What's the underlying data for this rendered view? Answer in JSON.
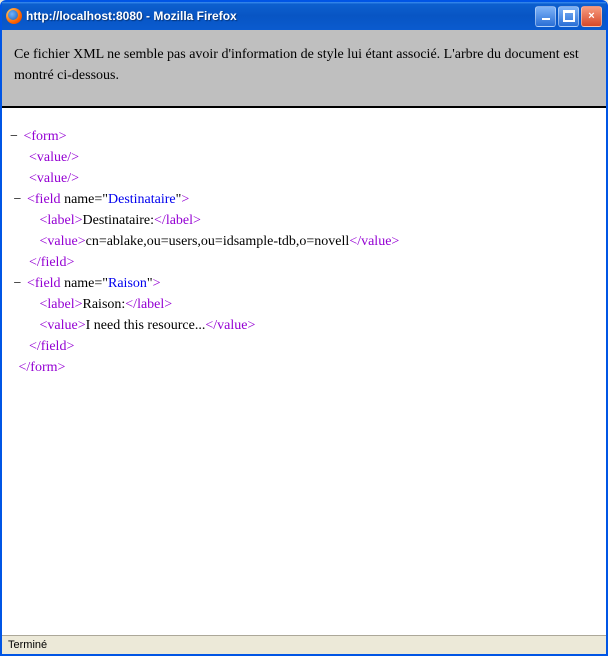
{
  "window": {
    "title": "http://localhost:8080 - Mozilla Firefox"
  },
  "banner": {
    "text": "Ce fichier XML ne semble pas avoir d'information de style lui étant associé. L'arbre du document est montré ci-dessous."
  },
  "xml": {
    "toggle": "−",
    "lines": [
      {
        "indent": 0,
        "toggle": true,
        "parts": [
          {
            "t": "tag",
            "v": "<form>"
          }
        ]
      },
      {
        "indent": 2,
        "toggle": false,
        "parts": [
          {
            "t": "tag",
            "v": "<value/>"
          }
        ]
      },
      {
        "indent": 2,
        "toggle": false,
        "parts": [
          {
            "t": "tag",
            "v": "<value/>"
          }
        ]
      },
      {
        "indent": 1,
        "toggle": true,
        "parts": [
          {
            "t": "tag",
            "v": "<field "
          },
          {
            "t": "attr-name",
            "v": "name=\""
          },
          {
            "t": "attr-val",
            "v": "Destinataire"
          },
          {
            "t": "attr-name",
            "v": "\""
          },
          {
            "t": "tag",
            "v": ">"
          }
        ]
      },
      {
        "indent": 3,
        "toggle": false,
        "parts": [
          {
            "t": "tag",
            "v": "<label>"
          },
          {
            "t": "text",
            "v": "Destinataire:"
          },
          {
            "t": "tag",
            "v": "</label>"
          }
        ]
      },
      {
        "indent": 3,
        "toggle": false,
        "parts": [
          {
            "t": "tag",
            "v": "<value>"
          },
          {
            "t": "text",
            "v": "cn=ablake,ou=users,ou=idsample-tdb,o=novell"
          },
          {
            "t": "tag",
            "v": "</value>"
          }
        ]
      },
      {
        "indent": 2,
        "toggle": false,
        "parts": [
          {
            "t": "tag",
            "v": "</field>"
          }
        ]
      },
      {
        "indent": 1,
        "toggle": true,
        "parts": [
          {
            "t": "tag",
            "v": "<field "
          },
          {
            "t": "attr-name",
            "v": "name=\""
          },
          {
            "t": "attr-val",
            "v": "Raison"
          },
          {
            "t": "attr-name",
            "v": "\""
          },
          {
            "t": "tag",
            "v": ">"
          }
        ]
      },
      {
        "indent": 3,
        "toggle": false,
        "parts": [
          {
            "t": "tag",
            "v": "<label>"
          },
          {
            "t": "text",
            "v": "Raison:"
          },
          {
            "t": "tag",
            "v": "</label>"
          }
        ]
      },
      {
        "indent": 3,
        "toggle": false,
        "parts": [
          {
            "t": "tag",
            "v": "<value>"
          },
          {
            "t": "text",
            "v": "I need this resource..."
          },
          {
            "t": "tag",
            "v": "</value>"
          }
        ]
      },
      {
        "indent": 2,
        "toggle": false,
        "parts": [
          {
            "t": "tag",
            "v": "</field>"
          }
        ]
      },
      {
        "indent": 1,
        "toggle": false,
        "parts": [
          {
            "t": "tag",
            "v": "</form>"
          }
        ]
      }
    ]
  },
  "status": {
    "text": "Terminé"
  }
}
